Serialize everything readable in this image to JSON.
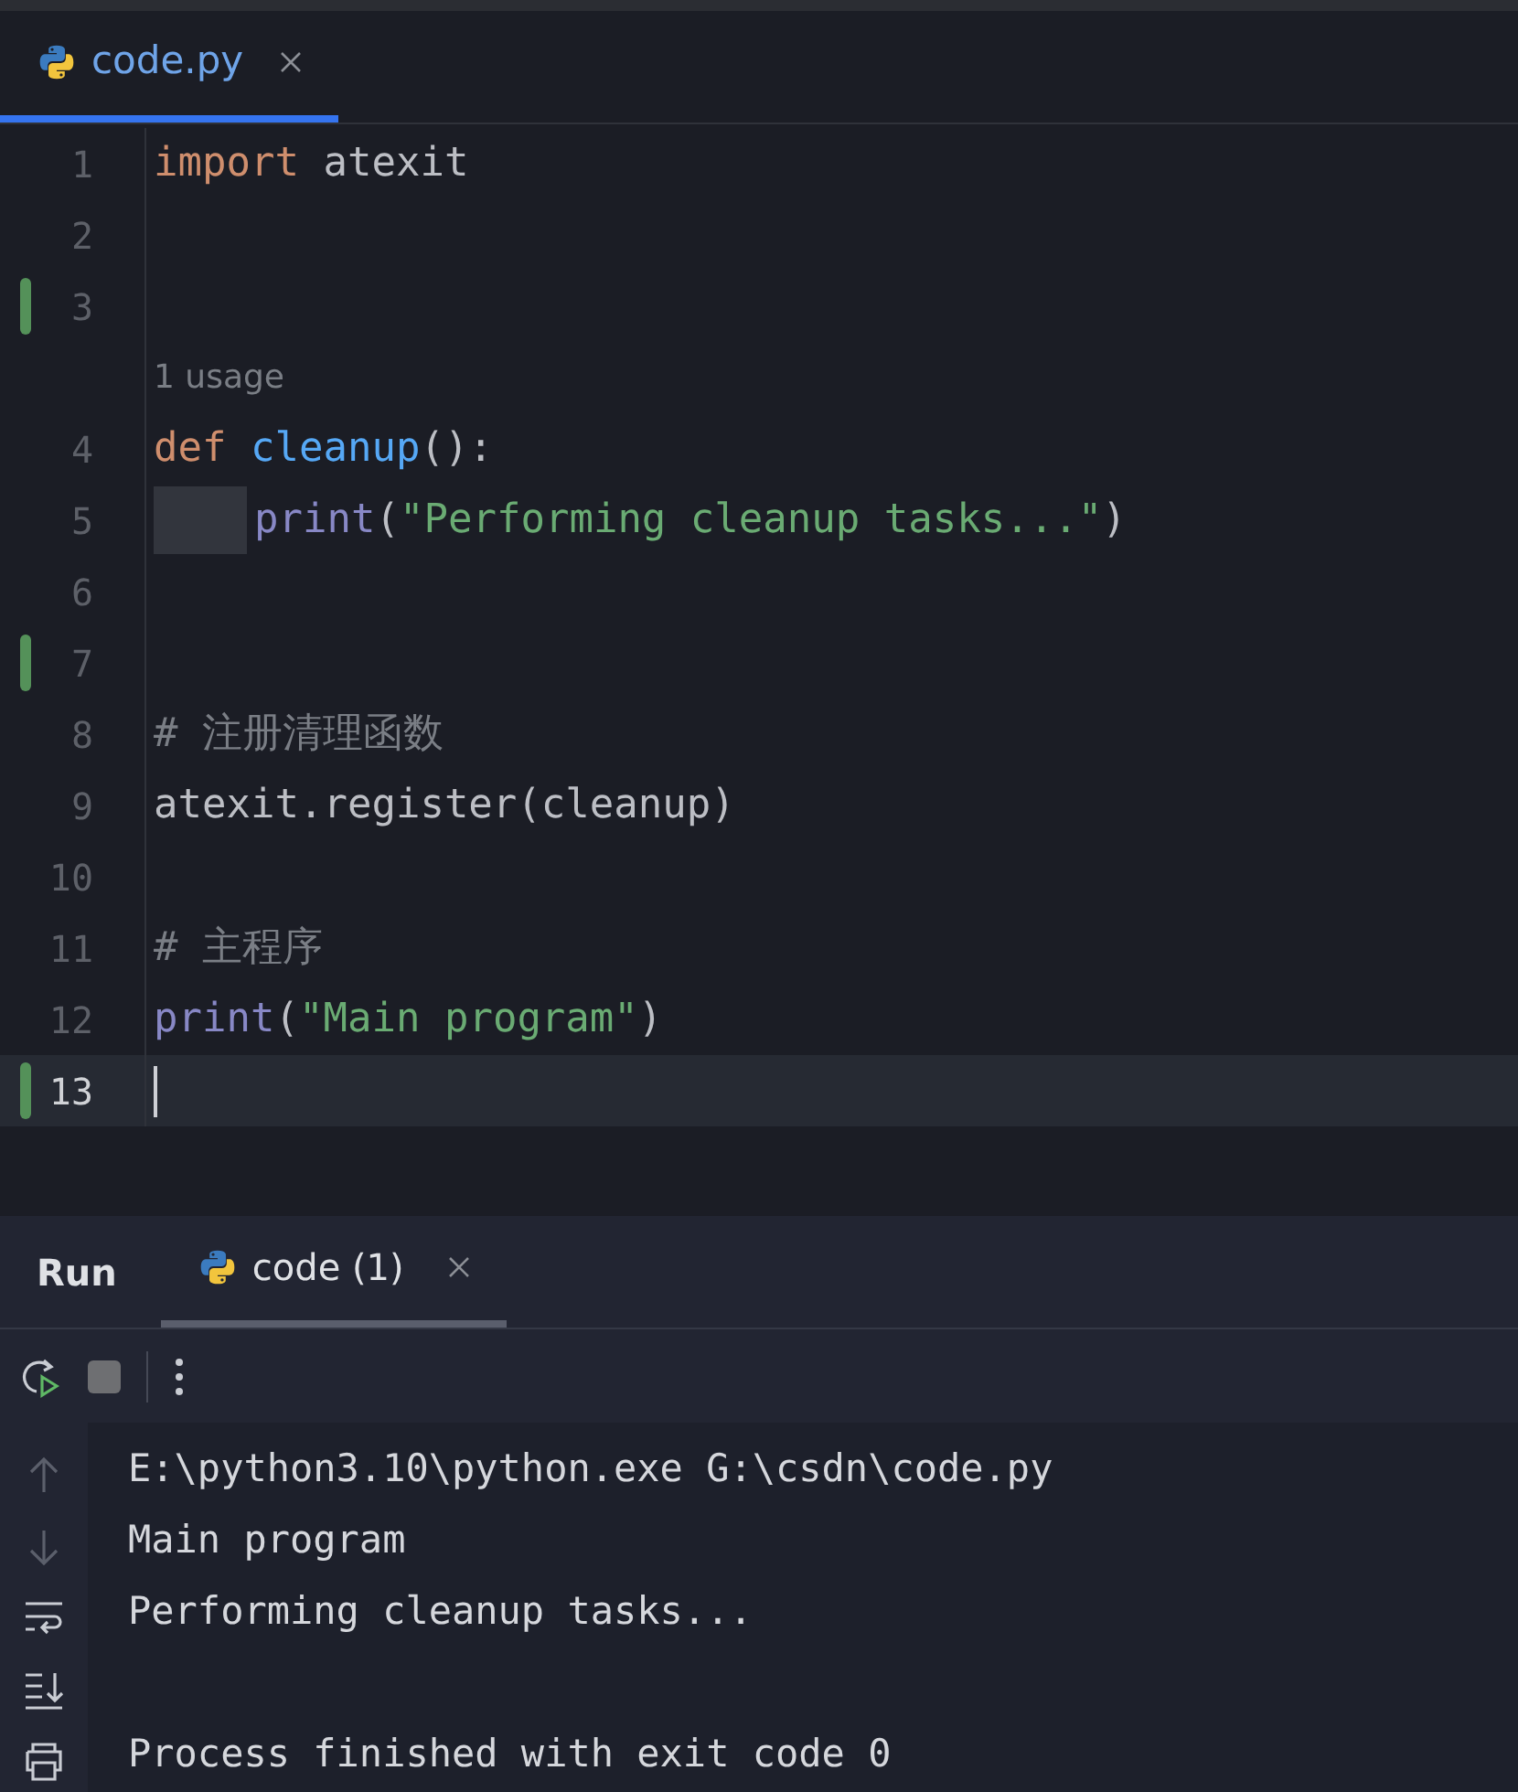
{
  "editor_tabs": [
    {
      "label": "code.py",
      "selected": true
    }
  ],
  "code": {
    "lines": [
      {
        "number": "1",
        "changed": false,
        "current": false,
        "tokens": [
          {
            "kind": "keyword",
            "text": "import"
          },
          {
            "kind": "plain",
            "text": " atexit"
          }
        ]
      },
      {
        "number": "2",
        "changed": false,
        "current": false
      },
      {
        "number": "3",
        "changed": true,
        "current": false
      },
      {
        "kind": "inlay",
        "text": "1 usage"
      },
      {
        "number": "4",
        "changed": false,
        "current": false,
        "tokens": [
          {
            "kind": "keyword",
            "text": "def "
          },
          {
            "kind": "function",
            "text": "cleanup"
          },
          {
            "kind": "plain",
            "text": "():"
          }
        ]
      },
      {
        "number": "5",
        "changed": false,
        "current": false,
        "indented": true,
        "tokens": [
          {
            "kind": "builtin",
            "text": "print"
          },
          {
            "kind": "plain",
            "text": "("
          },
          {
            "kind": "string",
            "text": "\"Performing cleanup tasks...\""
          },
          {
            "kind": "plain",
            "text": ")"
          }
        ]
      },
      {
        "number": "6",
        "changed": false,
        "current": false
      },
      {
        "number": "7",
        "changed": true,
        "current": false
      },
      {
        "number": "8",
        "changed": false,
        "current": false,
        "tokens": [
          {
            "kind": "comment",
            "text": "# 注册清理函数"
          }
        ]
      },
      {
        "number": "9",
        "changed": false,
        "current": false,
        "tokens": [
          {
            "kind": "plain",
            "text": "atexit.register(cleanup)"
          }
        ]
      },
      {
        "number": "10",
        "changed": false,
        "current": false
      },
      {
        "number": "11",
        "changed": false,
        "current": false,
        "tokens": [
          {
            "kind": "comment",
            "text": "# 主程序"
          }
        ]
      },
      {
        "number": "12",
        "changed": false,
        "current": false,
        "tokens": [
          {
            "kind": "builtin",
            "text": "print"
          },
          {
            "kind": "plain",
            "text": "("
          },
          {
            "kind": "string",
            "text": "\"Main program\""
          },
          {
            "kind": "plain",
            "text": ")"
          }
        ]
      },
      {
        "number": "13",
        "changed": true,
        "current": true
      }
    ]
  },
  "run_panel": {
    "title": "Run",
    "tabs": [
      {
        "label": "code (1)",
        "selected": true
      }
    ],
    "console": {
      "blocks": [
        [
          "E:\\python3.10\\python.exe G:\\csdn\\code.py",
          "Main program",
          "Performing cleanup tasks..."
        ],
        [
          "Process finished with exit code 0"
        ]
      ]
    }
  }
}
